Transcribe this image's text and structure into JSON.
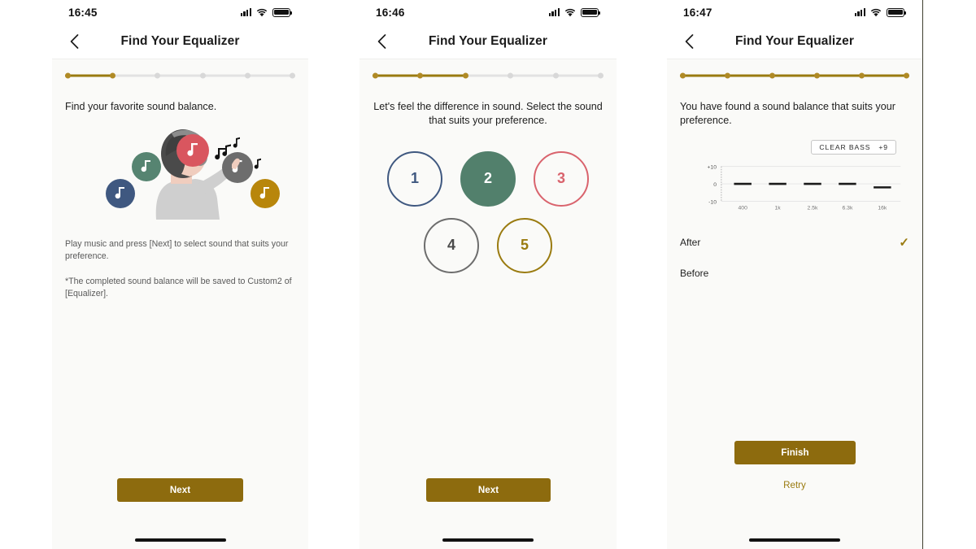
{
  "accent": {
    "gold": "#8d6b0e",
    "gold_light": "#b08a25",
    "gold_track": "#9a7b10",
    "track_gray": "#e2e2e2"
  },
  "phones": [
    {
      "id": "phone-1",
      "status": {
        "time": "16:45",
        "signal_icon": "signal-bars-icon",
        "wifi_icon": "wifi-icon",
        "battery_icon": "battery-full-icon"
      },
      "nav": {
        "back_icon": "chevron-left-icon",
        "title": "Find Your Equalizer"
      },
      "stepper": {
        "total": 6,
        "completed": 2
      },
      "lead": "Find your favorite sound balance.",
      "illustration_name": "person-with-headphones-selecting-sound-illustration",
      "helper_1": "Play music and press [Next] to select sound that suits your preference.",
      "helper_2": "*The completed sound balance will be saved to Custom2 of [Equalizer].",
      "primary_button": "Next"
    },
    {
      "id": "phone-2",
      "status": {
        "time": "16:46",
        "signal_icon": "signal-bars-icon",
        "wifi_icon": "wifi-icon",
        "battery_icon": "battery-full-icon"
      },
      "nav": {
        "back_icon": "chevron-left-icon",
        "title": "Find Your Equalizer"
      },
      "stepper": {
        "total": 6,
        "completed": 3
      },
      "lead": "Let's feel the difference in sound. Select the sound that suits your preference.",
      "choices": [
        {
          "label": "1",
          "color": "#3f5880",
          "selected": false
        },
        {
          "label": "2",
          "color": "#52806c",
          "selected": true
        },
        {
          "label": "3",
          "color": "#d9636d",
          "selected": false
        },
        {
          "label": "4",
          "color": "#6d6d6d",
          "selected": false
        },
        {
          "label": "5",
          "color": "#9a7b10",
          "selected": false
        }
      ],
      "primary_button": "Next"
    },
    {
      "id": "phone-3",
      "status": {
        "time": "16:47",
        "signal_icon": "signal-bars-icon",
        "wifi_icon": "wifi-icon",
        "battery_icon": "battery-full-icon"
      },
      "nav": {
        "back_icon": "chevron-left-icon",
        "title": "Find Your Equalizer"
      },
      "stepper": {
        "total": 6,
        "completed": 6
      },
      "lead": "You have found a sound balance that suits your preference.",
      "clear_bass": {
        "label": "CLEAR BASS",
        "value": "+9"
      },
      "compare": [
        {
          "label": "After",
          "checked": true,
          "check_icon": "check-icon"
        },
        {
          "label": "Before",
          "checked": false
        }
      ],
      "primary_button": "Finish",
      "secondary_button": "Retry"
    }
  ],
  "chart_data": {
    "type": "bar",
    "title": "",
    "categories": [
      "400",
      "1k",
      "2.5k",
      "6.3k",
      "16k"
    ],
    "values": [
      0,
      0,
      0,
      0,
      -2
    ],
    "ylabel": "",
    "xlabel": "",
    "ylim": [
      -10,
      10
    ],
    "ytick_labels": [
      "+10",
      "0",
      "-10"
    ],
    "ytick_values": [
      10,
      0,
      -10
    ],
    "grid": true,
    "legend": "none",
    "annotations": [
      "CLEAR BASS +9"
    ]
  }
}
